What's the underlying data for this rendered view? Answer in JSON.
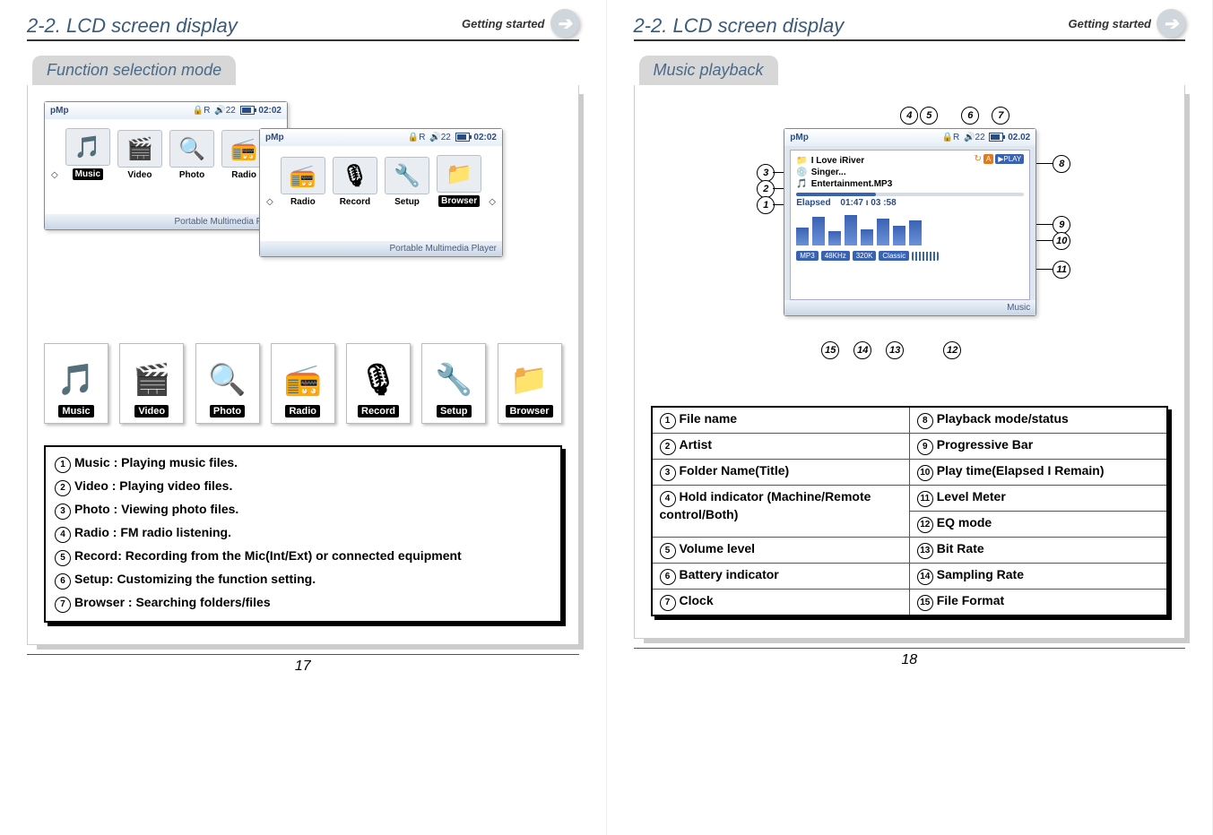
{
  "header": {
    "title": "2-2. LCD screen display",
    "sub": "Getting started"
  },
  "left": {
    "section_title": "Function selection mode",
    "screen_topbar": {
      "volume": "22",
      "clock": "02:02",
      "footer": "Portable Multimedia Player",
      "logo": "pMp"
    },
    "screen1_items": [
      {
        "label": "Music"
      },
      {
        "label": "Video"
      },
      {
        "label": "Photo"
      },
      {
        "label": "Radio"
      }
    ],
    "screen2_items": [
      {
        "label": "Radio"
      },
      {
        "label": "Record"
      },
      {
        "label": "Setup"
      },
      {
        "label": "Browser"
      }
    ],
    "big_icons": [
      {
        "label": "Music",
        "glyph": "🎵"
      },
      {
        "label": "Video",
        "glyph": "🎬"
      },
      {
        "label": "Photo",
        "glyph": "🔍"
      },
      {
        "label": "Radio",
        "glyph": "📻"
      },
      {
        "label": "Record",
        "glyph": "🎙"
      },
      {
        "label": "Setup",
        "glyph": "🔧"
      },
      {
        "label": "Browser",
        "glyph": "📁"
      }
    ],
    "legend": [
      "Music : Playing music files.",
      "Video : Playing video files.",
      "Photo : Viewing photo files.",
      "Radio : FM radio listening.",
      "Record: Recording from the Mic(Int/Ext) or connected equipment",
      "Setup: Customizing the function setting.",
      "Browser : Searching folders/files"
    ],
    "page_num": "17"
  },
  "right": {
    "section_title": "Music playback",
    "topbar": {
      "volume": "22",
      "clock": "02.02",
      "logo": "pMp",
      "repeat": "↻",
      "mode_a": "A",
      "mode_play": "▶PLAY"
    },
    "folder": "I Love iRiver",
    "artist": "Singer...",
    "filename": "Entertainment.MP3",
    "time_label": "Elapsed",
    "time_value": "01:47 ı 03 :58",
    "chips": {
      "format": "MP3",
      "sample": "48KHz",
      "bitrate": "320K",
      "eq": "Classic"
    },
    "footer": "Music",
    "legend_left": [
      "File name",
      "Artist",
      "Folder Name(Title)",
      "Hold indicator (Machine/Remote control/Both)",
      "Volume level",
      "Battery indicator",
      "Clock"
    ],
    "legend_right": [
      "Playback mode/status",
      "Progressive Bar",
      "Play time(Elapsed I Remain)",
      "Level Meter",
      "EQ mode",
      "Bit Rate",
      "Sampling Rate",
      "File Format"
    ],
    "legend_right_start": 8,
    "page_num": "18"
  }
}
